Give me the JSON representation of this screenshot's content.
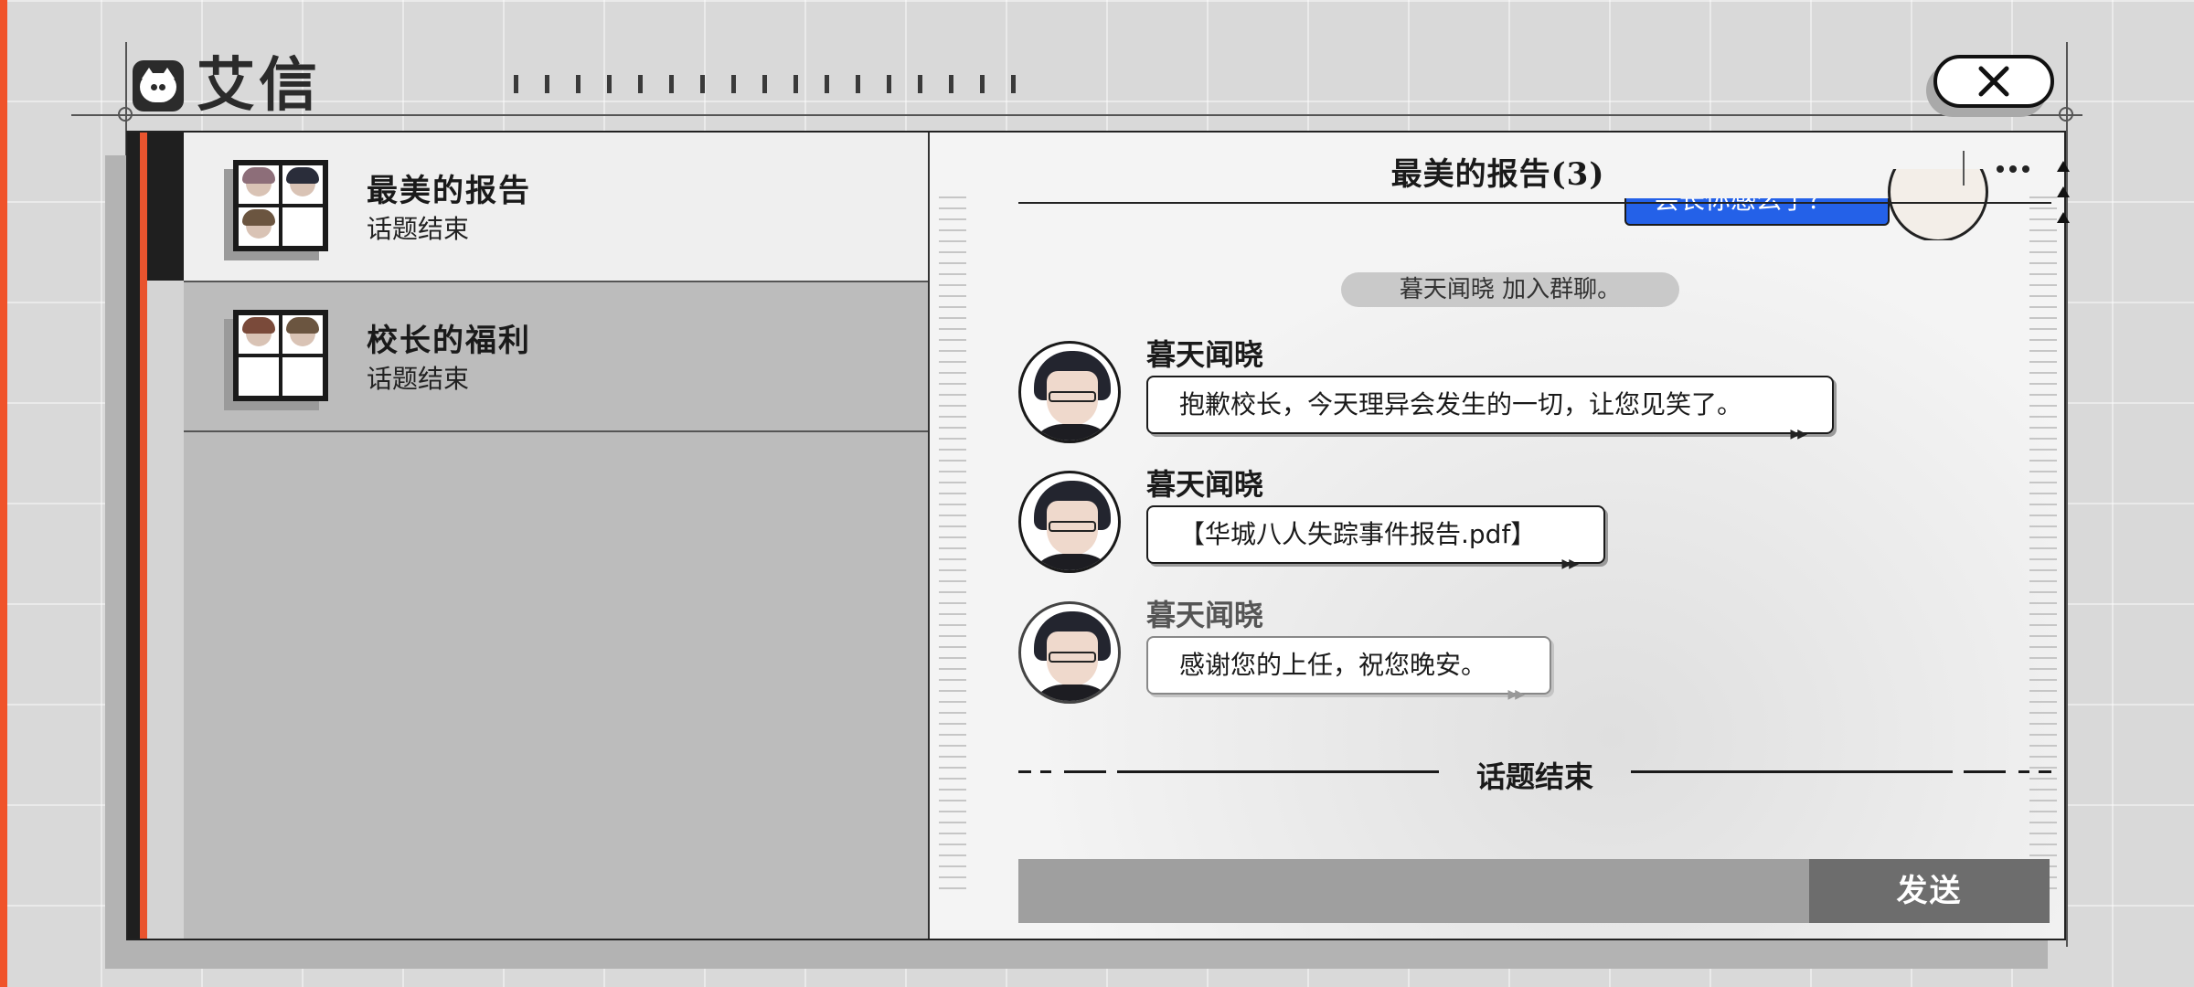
{
  "app": {
    "title": "艾信"
  },
  "chats": [
    {
      "name": "最美的报告",
      "status": "话题结束",
      "active": true
    },
    {
      "name": "校长的福利",
      "status": "话题结束",
      "active": false
    }
  ],
  "conversation": {
    "title": "最美的报告(3)",
    "previous_bubble": "会长你感么了？",
    "system_message": "暮天闻晓 加入群聊。",
    "messages": [
      {
        "sender": "暮天闻晓",
        "text": "抱歉校长，今天理异会发生的一切，让您见笑了。"
      },
      {
        "sender": "暮天闻晓",
        "text": "【华城八人失踪事件报告.pdf】"
      },
      {
        "sender": "暮天闻晓",
        "text": "感谢您的上任，祝您晚安。"
      }
    ],
    "end_label": "话题结束",
    "input_placeholder": "",
    "send_label": "发送"
  },
  "icons": {
    "logo": "cat-logo-icon",
    "close": "close-icon",
    "more": "more-dots-icon",
    "scroll": "scroll-up-icon"
  },
  "colors": {
    "accent_red": "#e9542e",
    "bubble_blue": "#2461e8",
    "send_button": "#6d6d6d"
  }
}
